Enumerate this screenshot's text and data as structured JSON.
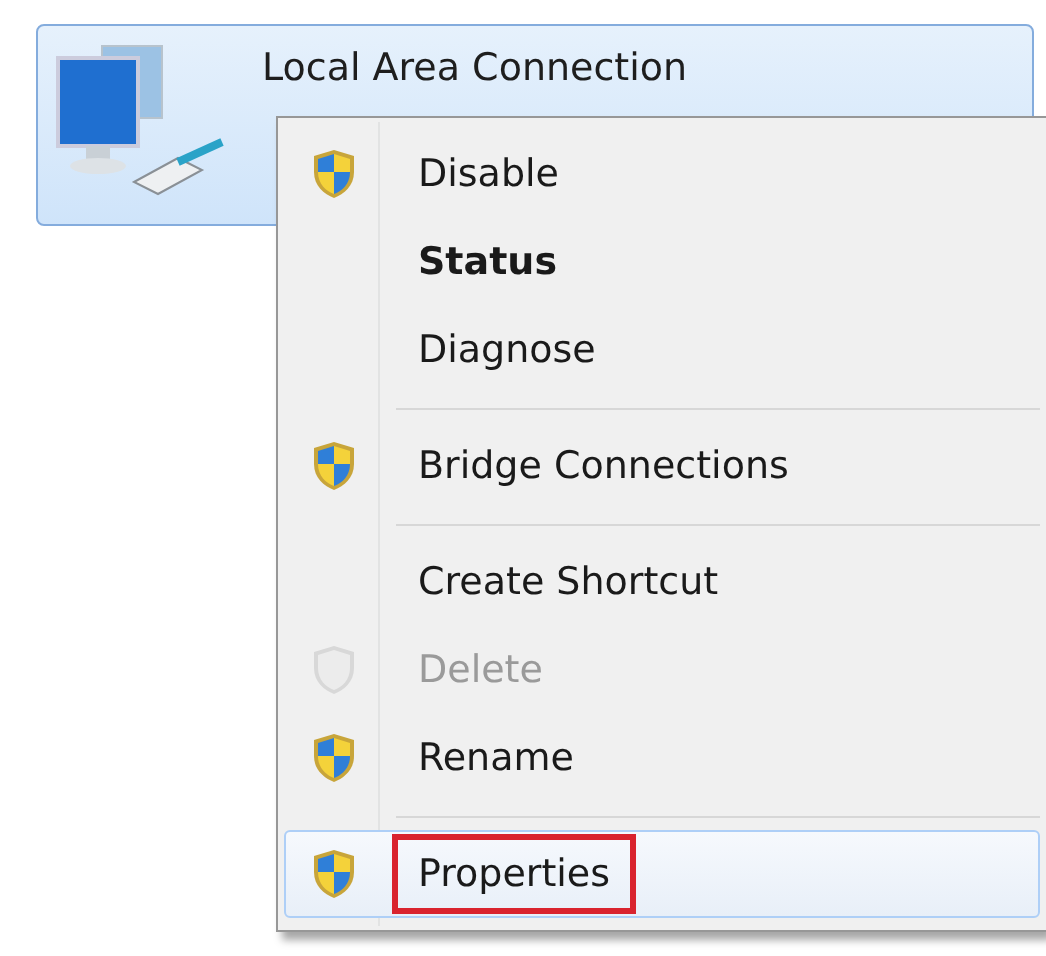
{
  "connection": {
    "name": "Local Area Connection",
    "selected": true
  },
  "context_menu": {
    "items": [
      {
        "label": "Disable",
        "kind": "shield",
        "default": false,
        "disabled": false,
        "selected": false,
        "annotated": false
      },
      {
        "label": "Status",
        "kind": "plain",
        "default": true,
        "disabled": false,
        "selected": false,
        "annotated": false
      },
      {
        "label": "Diagnose",
        "kind": "plain",
        "default": false,
        "disabled": false,
        "selected": false,
        "annotated": false
      },
      {
        "kind": "separator"
      },
      {
        "label": "Bridge Connections",
        "kind": "shield",
        "default": false,
        "disabled": false,
        "selected": false,
        "annotated": false
      },
      {
        "kind": "separator"
      },
      {
        "label": "Create Shortcut",
        "kind": "plain",
        "default": false,
        "disabled": false,
        "selected": false,
        "annotated": false
      },
      {
        "label": "Delete",
        "kind": "shield",
        "default": false,
        "disabled": true,
        "selected": false,
        "annotated": false
      },
      {
        "label": "Rename",
        "kind": "shield",
        "default": false,
        "disabled": false,
        "selected": false,
        "annotated": false
      },
      {
        "kind": "separator"
      },
      {
        "label": "Properties",
        "kind": "shield",
        "default": false,
        "disabled": false,
        "selected": true,
        "annotated": true
      }
    ]
  }
}
